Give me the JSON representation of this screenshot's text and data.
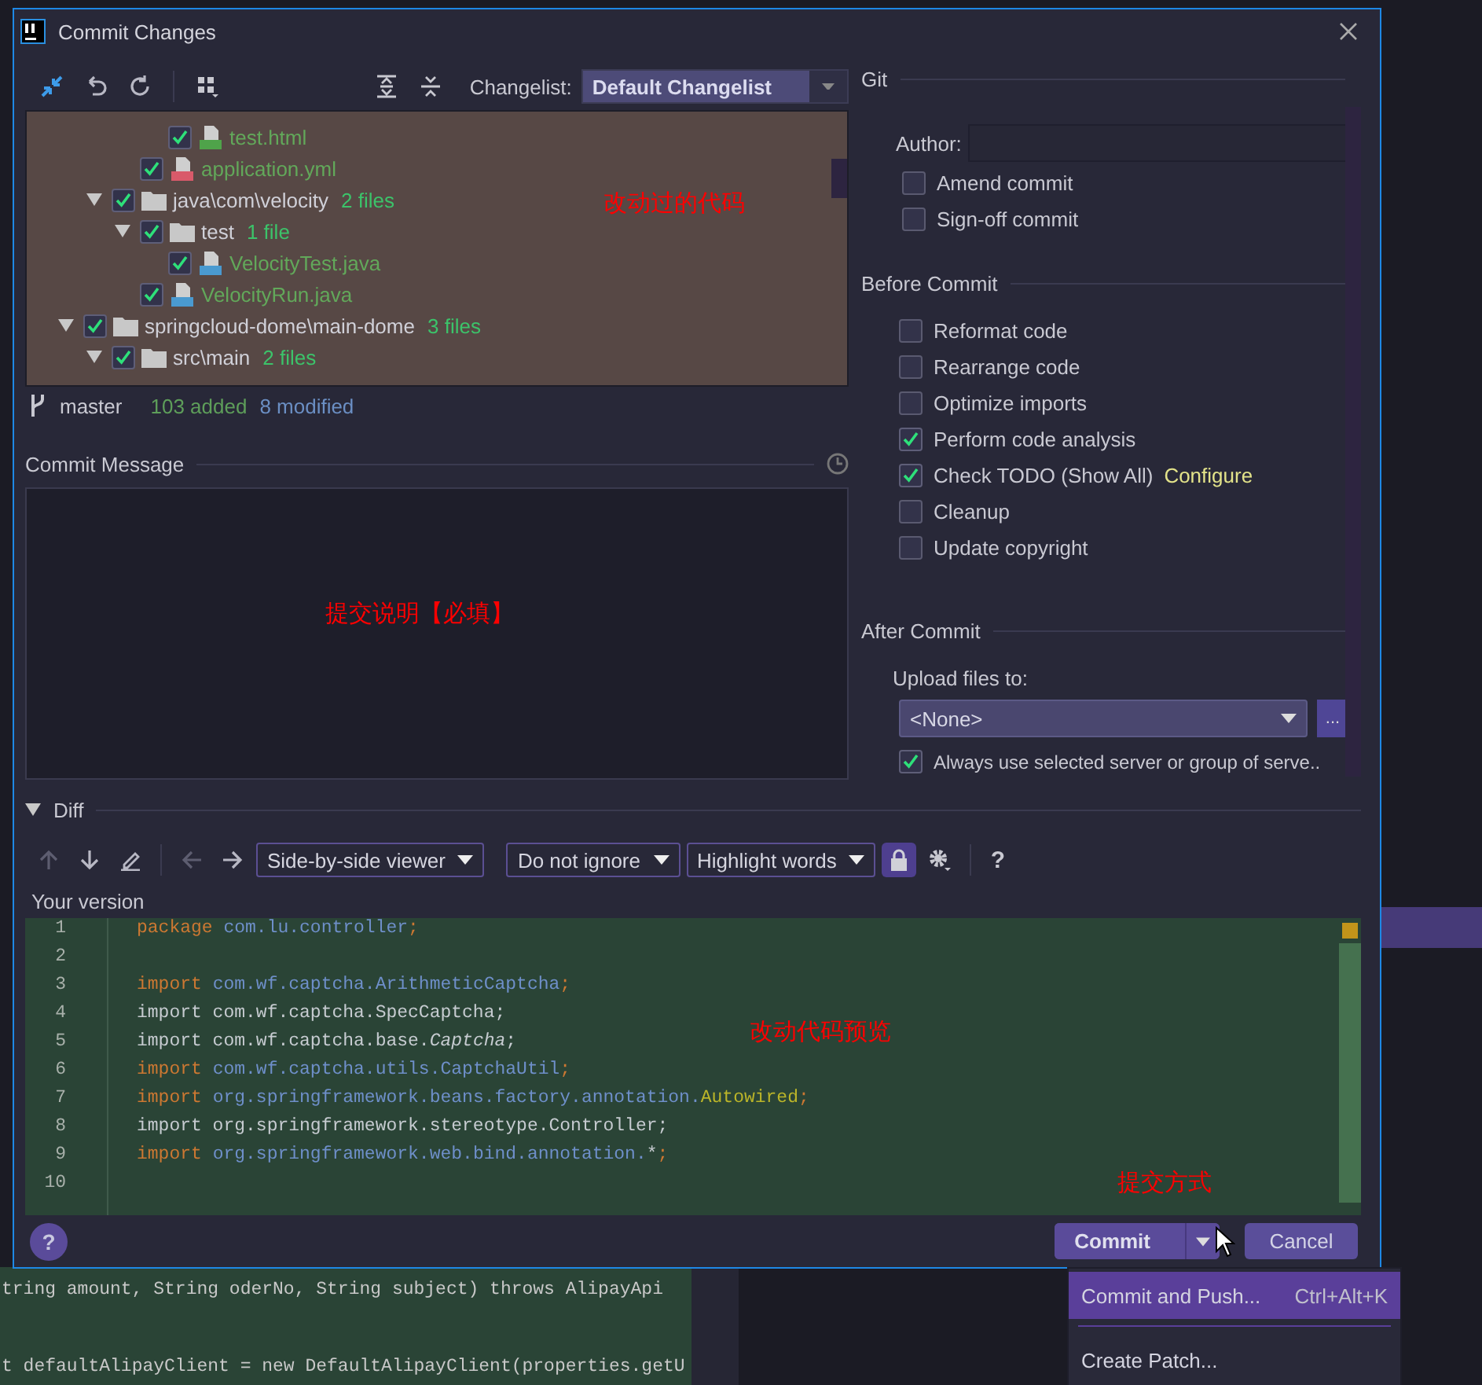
{
  "background": {
    "code_lines": [
      "tring amount, String oderNo, String subject) throws AlipayApi",
      "t defaultAlipayClient = new DefaultAlipayClient(properties.getU"
    ]
  },
  "window": {
    "title": "Commit Changes"
  },
  "changes": {
    "changelist_label": "Changelist:",
    "changelist": "Default Changelist",
    "tree": [
      {
        "children": [
          {
            "children": [
              {
                "children": [
                  {
                    "name": "test.html",
                    "kind": "html",
                    "checked": true
                  }
                ]
              },
              {
                "name": "application.yml",
                "kind": "yml",
                "checked": true
              }
            ]
          },
          {
            "name": "java\\com\\velocity",
            "kind": "folder",
            "count": "2 files",
            "checked": true,
            "expanded": true,
            "children": [
              {
                "name": "test",
                "kind": "folder",
                "count": "1 file",
                "checked": true,
                "expanded": true,
                "children": [
                  {
                    "name": "VelocityTest.java",
                    "kind": "java",
                    "checked": true
                  }
                ]
              },
              {
                "name": "VelocityRun.java",
                "kind": "java",
                "checked": true
              }
            ]
          }
        ]
      },
      {
        "name": "springcloud-dome\\main-dome",
        "kind": "folder",
        "count": "3 files",
        "checked": true,
        "expanded": true,
        "children": [
          {
            "name": "src\\main",
            "kind": "folder",
            "count": "2 files",
            "checked": true,
            "expanded": true
          }
        ]
      }
    ],
    "branch": "master",
    "added": "103 added",
    "modified": "8 modified"
  },
  "commit_message": {
    "label": "Commit Message"
  },
  "git": {
    "title": "Git",
    "author_label": "Author:",
    "options": [
      {
        "label": "Amend commit",
        "checked": false
      },
      {
        "label": "Sign-off commit",
        "checked": false
      }
    ]
  },
  "before_commit": {
    "title": "Before Commit",
    "options": [
      {
        "label": "Reformat code",
        "checked": false
      },
      {
        "label": "Rearrange code",
        "checked": false
      },
      {
        "label": "Optimize imports",
        "checked": false
      },
      {
        "label": "Perform code analysis",
        "checked": true
      },
      {
        "label": "Check TODO (Show All)",
        "link": "Configure",
        "checked": true
      },
      {
        "label": "Cleanup",
        "checked": false
      },
      {
        "label": "Update copyright",
        "checked": false
      }
    ]
  },
  "after_commit": {
    "title": "After Commit",
    "upload_label": "Upload files to:",
    "upload_value": "<None>",
    "browse": "...",
    "always_use": {
      "label": "Always use selected server or group of serve..",
      "checked": true
    }
  },
  "diff": {
    "title": "Diff",
    "expanded": true,
    "selects": [
      "Side-by-side viewer",
      "Do not ignore",
      "Highlight words"
    ],
    "lock_on": true,
    "help": "?",
    "version_label": "Your version",
    "lines": [
      {
        "number": "1",
        "tokens": [
          {
            "text": "package ",
            "kind": "keyword"
          },
          {
            "text": "com.lu.controller",
            "kind": "name"
          },
          {
            "text": ";",
            "kind": "keyword"
          }
        ]
      },
      {
        "number": "2"
      },
      {
        "number": "3",
        "tokens": [
          {
            "text": "import ",
            "kind": "keyword"
          },
          {
            "text": "com.wf.captcha.ArithmeticCaptcha",
            "kind": "name"
          },
          {
            "text": ";",
            "kind": "keyword"
          }
        ]
      },
      {
        "number": "4",
        "tokens": [
          {
            "text": "import com.wf.captcha.SpecCaptcha;",
            "kind": "plain"
          }
        ]
      },
      {
        "number": "5",
        "tokens": [
          {
            "text": "import com.wf.captcha.base.",
            "kind": "plain"
          },
          {
            "text": "Captcha",
            "kind": "italic"
          },
          {
            "text": ";",
            "kind": "plain"
          }
        ]
      },
      {
        "number": "6",
        "tokens": [
          {
            "text": "import ",
            "kind": "keyword"
          },
          {
            "text": "com.wf.captcha.utils.CaptchaUtil",
            "kind": "name"
          },
          {
            "text": ";",
            "kind": "keyword"
          }
        ]
      },
      {
        "number": "7",
        "tokens": [
          {
            "text": "import ",
            "kind": "keyword"
          },
          {
            "text": "org.springframework.beans.factory.annotation.",
            "kind": "name"
          },
          {
            "text": "Autowired",
            "kind": "annotation"
          },
          {
            "text": ";",
            "kind": "keyword"
          }
        ]
      },
      {
        "number": "8",
        "tokens": [
          {
            "text": "import org.springframework.stereotype.Controller;",
            "kind": "plain"
          }
        ]
      },
      {
        "number": "9",
        "tokens": [
          {
            "text": "import ",
            "kind": "keyword"
          },
          {
            "text": "org.springframework.web.bind.annotation.",
            "kind": "name"
          },
          {
            "text": "*",
            "kind": "plain"
          },
          {
            "text": ";",
            "kind": "keyword"
          }
        ]
      },
      {
        "number": "10"
      }
    ]
  },
  "footer": {
    "help": "?",
    "commit": "Commit",
    "cancel": "Cancel"
  },
  "commit_menu": [
    {
      "label": "Commit and Push...",
      "shortcut": "Ctrl+Alt+K",
      "selected": true
    },
    {
      "label": "Create Patch...",
      "selected": false
    }
  ],
  "annotations": [
    {
      "text": "改动过的代码"
    },
    {
      "text": "提交说明【必填】"
    },
    {
      "text": "改动代码预览"
    },
    {
      "text": "提交方式"
    }
  ]
}
